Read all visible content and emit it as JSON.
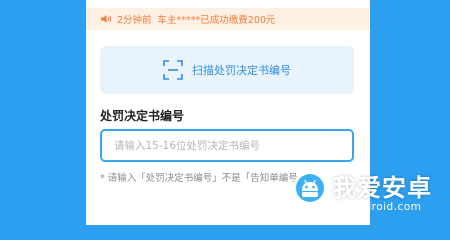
{
  "notice": {
    "time_text": "2分钟前",
    "user_text": "车主*****已成功缴费200元",
    "icon": "speaker-icon"
  },
  "scan": {
    "label": "扫描处罚决定书编号",
    "icon": "scan-frame-icon"
  },
  "form": {
    "section_title": "处罚决定书编号",
    "input_placeholder": "请输入15-16位处罚决定书编号",
    "input_value": "",
    "hint": "* 请输入「处罚决定书编号」不是「告知单编号」"
  },
  "watermark": {
    "title": "我爱安卓",
    "domain": "52android.com"
  },
  "colors": {
    "page_background": "#2d9ff0",
    "notice_text": "#f07d3a",
    "notice_background": "#fdf0e4",
    "accent": "#2d8fe0",
    "input_border": "#38a7ef"
  }
}
